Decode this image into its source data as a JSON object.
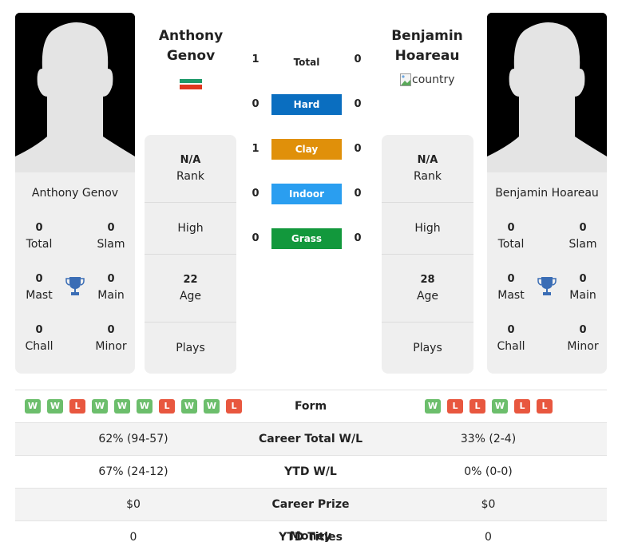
{
  "players": [
    {
      "name_line1": "Anthony",
      "name_line2": "Genov",
      "full_name": "Anthony Genov",
      "flag": "bulgaria-flag",
      "titles": {
        "total": {
          "value": "0",
          "label": "Total"
        },
        "slam": {
          "value": "0",
          "label": "Slam"
        },
        "mast": {
          "value": "0",
          "label": "Mast"
        },
        "main": {
          "value": "0",
          "label": "Main"
        },
        "chall": {
          "value": "0",
          "label": "Chall"
        },
        "minor": {
          "value": "0",
          "label": "Minor"
        }
      },
      "info": {
        "rank_value": "N/A",
        "rank_label": "Rank",
        "high_label": "High",
        "age_value": "22",
        "age_label": "Age",
        "plays_label": "Plays"
      }
    },
    {
      "name_line1": "Benjamin",
      "name_line2": "Hoareau",
      "full_name": "Benjamin Hoareau",
      "flag_alt": "country",
      "titles": {
        "total": {
          "value": "0",
          "label": "Total"
        },
        "slam": {
          "value": "0",
          "label": "Slam"
        },
        "mast": {
          "value": "0",
          "label": "Mast"
        },
        "main": {
          "value": "0",
          "label": "Main"
        },
        "chall": {
          "value": "0",
          "label": "Chall"
        },
        "minor": {
          "value": "0",
          "label": "Minor"
        }
      },
      "info": {
        "rank_value": "N/A",
        "rank_label": "Rank",
        "high_label": "High",
        "age_value": "28",
        "age_label": "Age",
        "plays_label": "Plays"
      }
    }
  ],
  "h2h": [
    {
      "label": "Total",
      "left": "1",
      "right": "0",
      "color": null
    },
    {
      "label": "Hard",
      "left": "0",
      "right": "0",
      "color": "#0a6ec0"
    },
    {
      "label": "Clay",
      "left": "1",
      "right": "0",
      "color": "#e0900a"
    },
    {
      "label": "Indoor",
      "left": "0",
      "right": "0",
      "color": "#2a9ef0"
    },
    {
      "label": "Grass",
      "left": "0",
      "right": "0",
      "color": "#12983c"
    }
  ],
  "stats": {
    "form": {
      "label": "Form",
      "left": [
        "W",
        "W",
        "L",
        "W",
        "W",
        "W",
        "L",
        "W",
        "W",
        "L"
      ],
      "right": [
        "W",
        "L",
        "L",
        "W",
        "L",
        "L"
      ]
    },
    "rows": [
      {
        "label": "Career Total W/L",
        "left": "62% (94-57)",
        "right": "33% (2-4)"
      },
      {
        "label": "YTD W/L",
        "left": "67% (24-12)",
        "right": "0% (0-0)"
      },
      {
        "label": "Career Prize Money",
        "left": "$0",
        "right": "$0"
      },
      {
        "label": "YTD Titles",
        "left": "0",
        "right": "0"
      }
    ]
  },
  "colors": {
    "win": "#6cbe6c",
    "loss": "#e8573f",
    "trophy": "#3a6db5"
  }
}
